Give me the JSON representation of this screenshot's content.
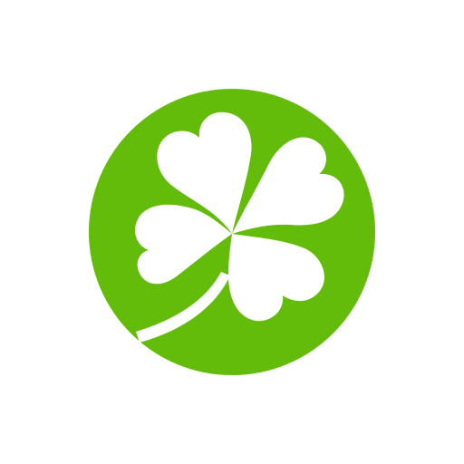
{
  "icon": {
    "name": "four-leaf-clover-icon",
    "background_color": "#ffffff",
    "circle_color": "#63bb0a",
    "clover_color": "#ffffff"
  }
}
